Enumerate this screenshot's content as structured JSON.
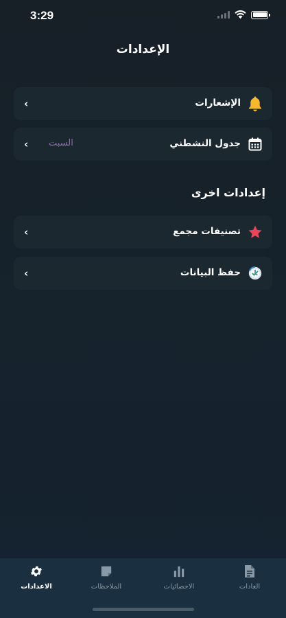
{
  "status_bar": {
    "time": "3:29"
  },
  "header": {
    "title": "الإعدادات"
  },
  "rows": [
    {
      "label": "الإشعارات",
      "value": "",
      "icon": "bell-icon"
    },
    {
      "label": "جدول النشطني",
      "value": "السبت",
      "icon": "calendar-icon"
    },
    {
      "label": "تصنيفات مجمع",
      "value": "",
      "icon": "star-icon"
    },
    {
      "label": "حفظ البيانات",
      "value": "",
      "icon": "backup-clock-icon"
    }
  ],
  "section": {
    "other_title": "إعدادات اخرى"
  },
  "tabs": [
    {
      "label": "الاعدادات",
      "icon": "gear-icon",
      "active": true
    },
    {
      "label": "الملاحظات",
      "icon": "note-icon",
      "active": false
    },
    {
      "label": "الاحصائيات",
      "icon": "bar-chart-icon",
      "active": false
    },
    {
      "label": "العادات",
      "icon": "document-icon",
      "active": false
    }
  ],
  "colors": {
    "background": "#172027",
    "row_bg": "#1c2830",
    "accent_value": "#8d6bb0",
    "bell": "#f6b92e",
    "star": "#e8445a",
    "tab_bar": "#1a3040"
  }
}
